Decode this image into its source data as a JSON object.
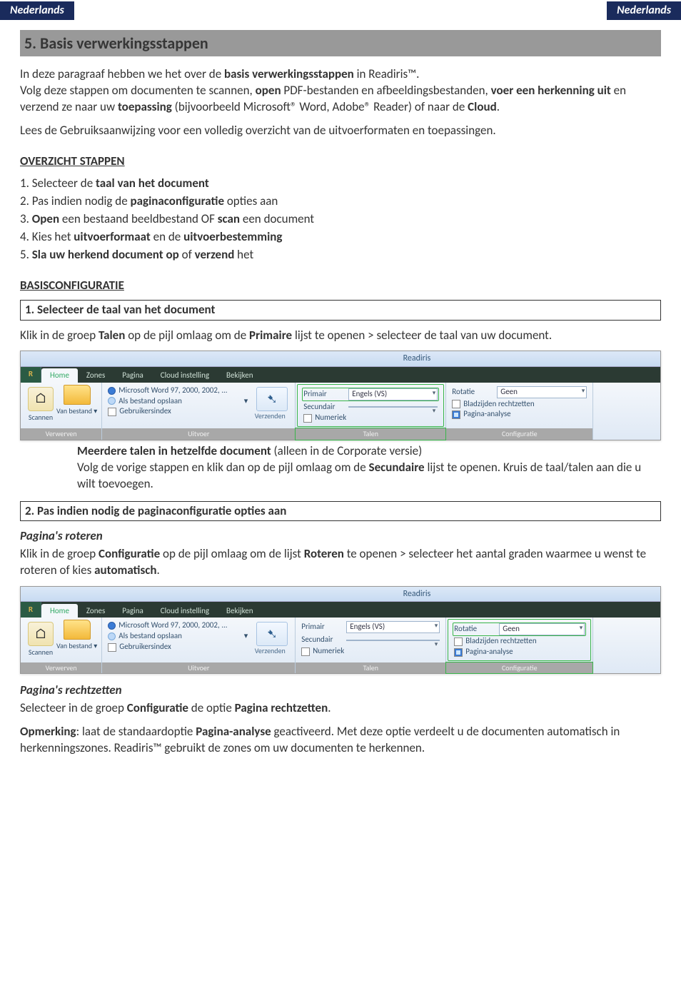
{
  "header": {
    "left": "Nederlands",
    "right": "Nederlands"
  },
  "section_title": "5. Basis verwerkingsstappen",
  "intro1_pre": "In deze paragraaf hebben we het over de ",
  "intro1_b1": "basis verwerkingsstappen",
  "intro1_post": " in Readiris™.",
  "intro2_pre": "Volg deze stappen om documenten te scannen, ",
  "intro2_b1": "open",
  "intro2_mid1": " PDF-bestanden en afbeeldingsbestanden, ",
  "intro2_b2": "voer een herkenning uit",
  "intro2_mid2": " en verzend ze naar uw ",
  "intro2_b3": "toepassing",
  "intro2_mid3": " (bijvoorbeeld Microsoft® Word, Adobe® Reader) of naar de ",
  "intro2_b4": "Cloud",
  "intro2_end": ".",
  "intro3": "Lees de Gebruiksaanwijzing voor een volledig overzicht van de uitvoerformaten en toepassingen.",
  "overview_head": "OVERZICHT STAPPEN ",
  "steps": {
    "s1_pre": "1. Selecteer de ",
    "s1_b": "taal van het document",
    "s2_pre": "2. Pas indien nodig de ",
    "s2_b": "paginaconfiguratie",
    "s2_post": " opties aan",
    "s3_pre": "3. ",
    "s3_b1": "Open",
    "s3_mid": " een bestaand beeldbestand OF ",
    "s3_b2": "scan",
    "s3_post": " een document",
    "s4_pre": "4. Kies het ",
    "s4_b1": "uitvoerformaat",
    "s4_mid": " en de ",
    "s4_b2": "uitvoerbestemming",
    "s5_pre": "5. ",
    "s5_b1": "Sla uw herkend document op",
    "s5_mid": " of ",
    "s5_b2": "verzend",
    "s5_post": " het"
  },
  "basis_head": "BASISCONFIGURATIE",
  "box1": "1. Selecteer de taal van het document",
  "para1_pre": "Klik in de groep ",
  "para1_b1": "Talen",
  "para1_mid": " op de pijl omlaag om de ",
  "para1_b2": "Primaire",
  "para1_post": " lijst te openen > selecteer de taal van uw document.",
  "ribbon": {
    "app_title": "Readiris",
    "tabs": {
      "home": "Home",
      "zones": "Zones",
      "pagina": "Pagina",
      "cloud": "Cloud instelling",
      "bekijken": "Bekijken"
    },
    "groups": {
      "verwerven": "Verwerven",
      "uitvoer": "Uitvoer",
      "talen": "Talen",
      "configuratie": "Configuratie"
    },
    "verwerven": {
      "scannen": "Scannen",
      "van_bestand": "Van bestand ▾"
    },
    "uitvoer": {
      "word": "Microsoft Word 97, 2000, 2002, ...",
      "als_bestand": "Als bestand opslaan",
      "gebruikers": "Gebruikersindex",
      "verzenden": "Verzenden"
    },
    "talen": {
      "primair_lbl": "Primair",
      "primair_val": "Engels (VS)",
      "secundair_lbl": "Secundair",
      "numeriek": "Numeriek"
    },
    "config": {
      "rotatie_lbl": "Rotatie",
      "rotatie_val": "Geen",
      "recht": "Bladzijden rechtzetten",
      "analyse": "Pagina-analyse"
    }
  },
  "multi_b": "Meerdere talen in hetzelfde document",
  "multi_post": " (alleen in de Corporate versie)",
  "multi2_pre": "Volg de vorige stappen en klik dan op de pijl omlaag om de ",
  "multi2_b": "Secundaire",
  "multi2_post": " lijst te openen. Kruis de taal/talen aan die u wilt toevoegen.",
  "box2": "2. Pas indien nodig de paginaconfiguratie opties aan",
  "roteren_head": "Pagina's roteren",
  "rot_pre": "Klik in de groep ",
  "rot_b1": "Configuratie",
  "rot_mid": " op de pijl omlaag om de lijst ",
  "rot_b2": "Roteren",
  "rot_mid2": " te openen > selecteer het aantal graden waarmee u wenst te roteren of kies ",
  "rot_b3": "automatisch",
  "rot_end": ".",
  "recht_head": "Pagina's rechtzetten",
  "recht_pre": "Selecteer in de groep ",
  "recht_b1": "Configuratie",
  "recht_mid": " de optie ",
  "recht_b2": "Pagina rechtzetten",
  "recht_end": ".",
  "opm_b": "Opmerking",
  "opm_pre": ": laat de standaardoptie ",
  "opm_b2": "Pagina-analyse",
  "opm_post": " geactiveerd. Met deze optie verdeelt u de documenten automatisch in herkenningszones. Readiris™ gebruikt de zones om uw documenten te herkennen."
}
